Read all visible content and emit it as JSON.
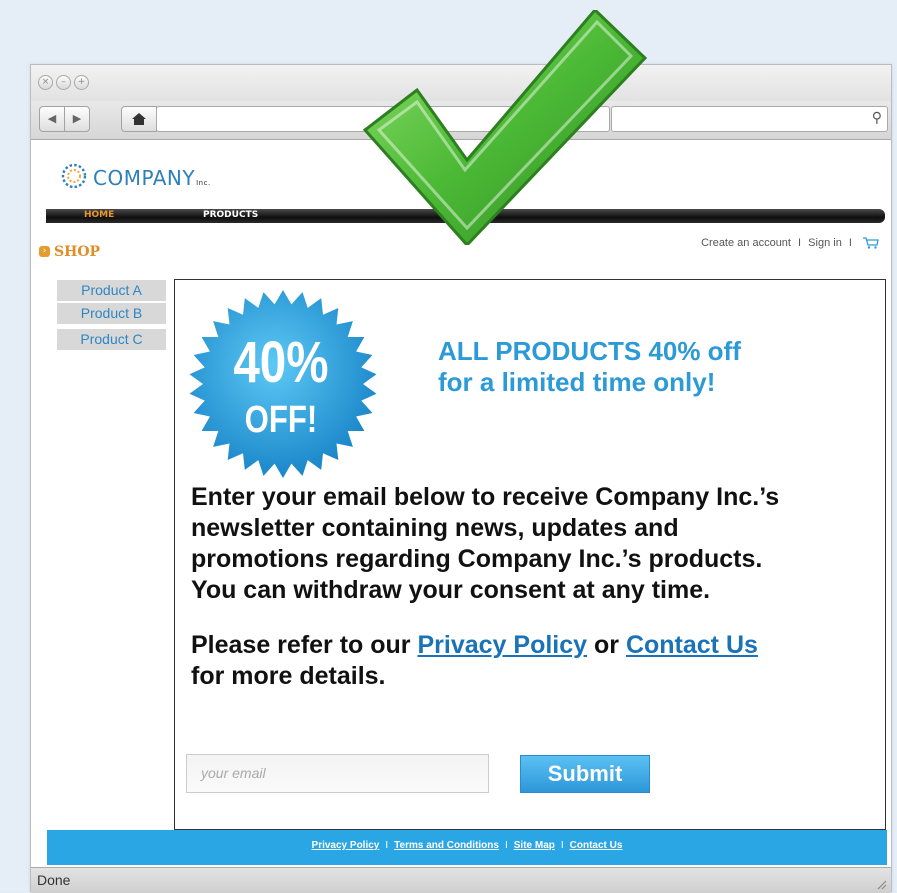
{
  "colors": {
    "accent_blue": "#2c9ad6",
    "link_blue": "#1a72b8",
    "footer_blue": "#2aa6e4",
    "shop_orange": "#e28c26",
    "check_green": "#4cb936"
  },
  "browser": {
    "status": "Done",
    "icons": [
      "close-icon",
      "minimize-icon",
      "zoom-icon",
      "back-icon",
      "forward-icon",
      "home-icon",
      "search-icon"
    ]
  },
  "site": {
    "logo_text": "COMPANY",
    "logo_suffix": "Inc.",
    "nav": [
      "HOME",
      "PRODUCTS"
    ],
    "shop_label": "SHOP",
    "account": {
      "create": "Create an account",
      "sep": "I",
      "sign_in": "Sign in"
    },
    "products": [
      "Product A",
      "Product B",
      "Product C"
    ]
  },
  "promo": {
    "badge_big": "40%",
    "badge_small": "OFF!",
    "headline_line1": "ALL PRODUCTS 40% off",
    "headline_line2": "for a limited time only!"
  },
  "newsletter": {
    "body_line1": "Enter your email below to receive Company Inc.’s",
    "body_line2": "newsletter containing news, updates and",
    "body_line3": "promotions regarding Company Inc.’s products.",
    "body_line4": "You can withdraw your consent at any time.",
    "refer_prefix": "Please refer to our",
    "privacy_link": "Privacy Policy",
    "refer_or": "or",
    "contact_link": "Contact Us",
    "refer_suffix": "for more details.",
    "email_placeholder": "your email",
    "submit": "Submit"
  },
  "footer": {
    "links": [
      "Privacy Policy",
      "Terms and Conditions",
      "Site Map",
      "Contact Us"
    ],
    "sep": "I"
  }
}
